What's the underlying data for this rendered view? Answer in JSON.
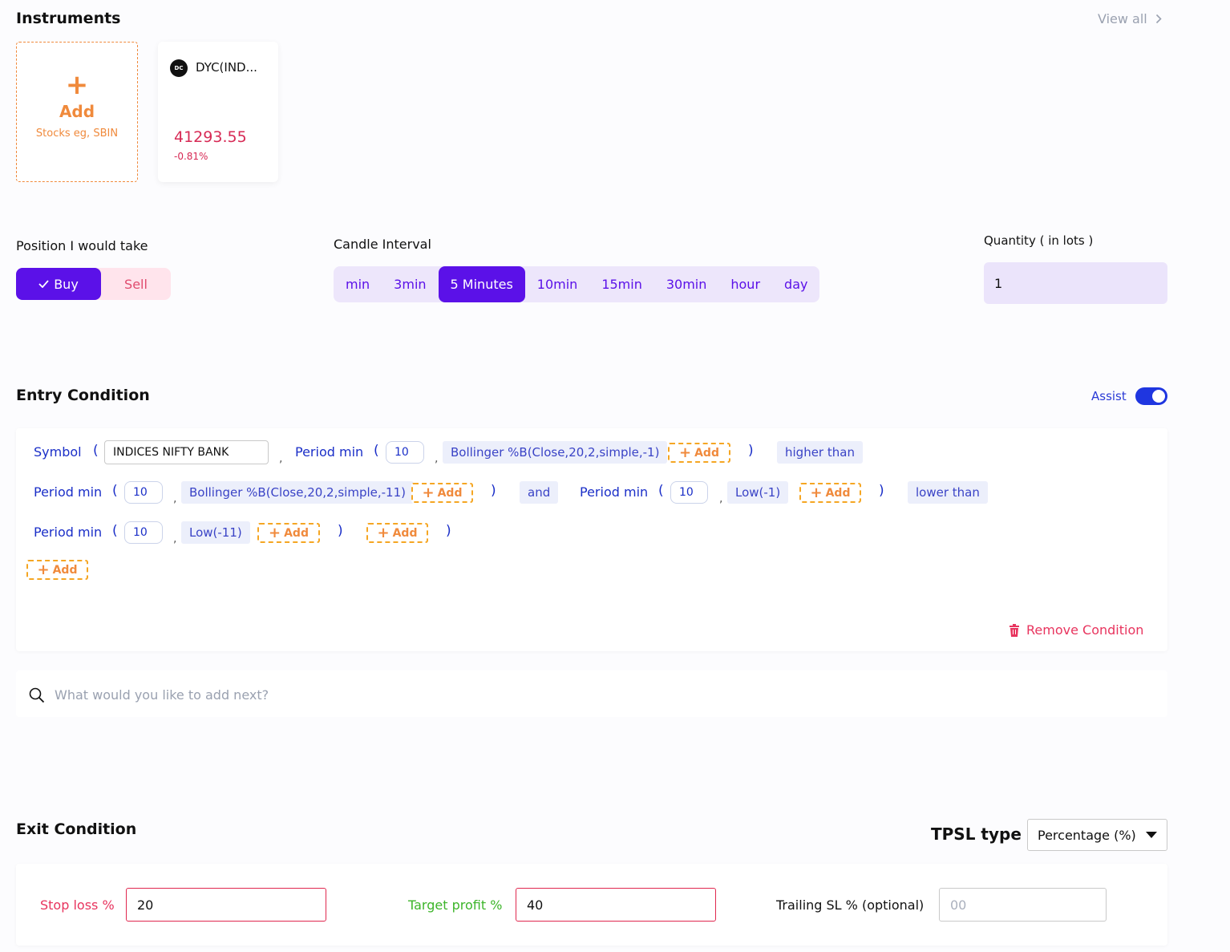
{
  "instruments": {
    "title": "Instruments",
    "view_all": "View all",
    "add_card": {
      "plus": "+",
      "label": "Add",
      "hint": "Stocks eg, SBIN"
    },
    "cards": [
      {
        "logo_text": "DC",
        "name": "DYC(IND...",
        "price": "41293.55",
        "change": "-0.81%"
      }
    ]
  },
  "position": {
    "label": "Position I would take",
    "buy": "Buy",
    "sell": "Sell",
    "selected": "Buy"
  },
  "candle_interval": {
    "label": "Candle Interval",
    "options": [
      "min",
      "3min",
      "5 Minutes",
      "10min",
      "15min",
      "30min",
      "hour",
      "day"
    ],
    "selected": "5 Minutes"
  },
  "quantity": {
    "label": "Quantity ( in lots )",
    "value": "1"
  },
  "entry": {
    "title": "Entry Condition",
    "assist_label": "Assist",
    "assist_on": true,
    "row1": {
      "symbol_kw": "Symbol",
      "open": "(",
      "symbol_value": "INDICES NIFTY BANK",
      "comma": ",",
      "period_kw": "Period min",
      "period_value": "10",
      "indicator": "Bollinger %B(Close,20,2,simple,-1)",
      "add": "Add",
      "close": ")",
      "operator": "higher than"
    },
    "row2": {
      "period_kw": "Period min",
      "period_value": "10",
      "indicator": "Bollinger %B(Close,20,2,simple,-11)",
      "add": "Add",
      "and": "and",
      "period_kw2": "Period min",
      "period_value2": "10",
      "indicator2": "Low(-1)",
      "operator": "lower than"
    },
    "row3": {
      "period_kw": "Period min",
      "period_value": "10",
      "indicator": "Low(-11)",
      "add": "Add"
    },
    "add_bottom": "Add",
    "remove": "Remove Condition"
  },
  "search": {
    "placeholder": "What would you like to add next?"
  },
  "exit": {
    "title": "Exit Condition",
    "tpsl_label": "TPSL type",
    "tpsl_value": "Percentage (%)",
    "stop_loss_label": "Stop loss %",
    "stop_loss_value": "20",
    "target_label": "Target profit %",
    "target_value": "40",
    "trailing_label": "Trailing SL % (optional)",
    "trailing_placeholder": "00"
  },
  "colors": {
    "accent": "#5b11e8",
    "orange": "#f08a3c",
    "red": "#e8345e",
    "green": "#3db52a",
    "blue": "#1b2fc8"
  }
}
